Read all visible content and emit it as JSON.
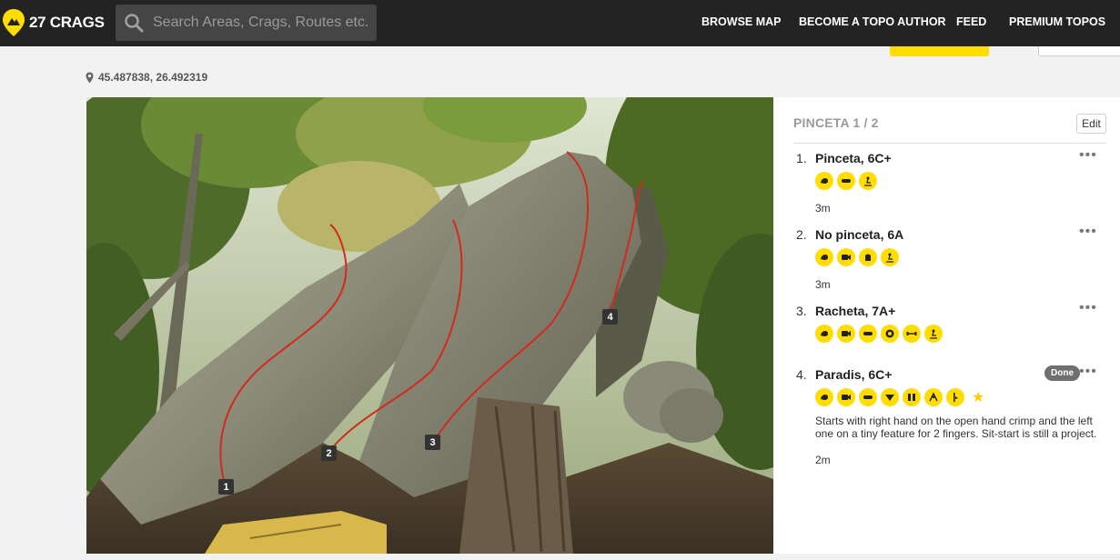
{
  "header": {
    "brand": "27 CRAGS",
    "search_placeholder": "Search Areas, Crags, Routes etc.",
    "nav": [
      "BROWSE MAP",
      "BECOME A TOPO AUTHOR",
      "FEED",
      "PREMIUM TOPOS"
    ]
  },
  "location": {
    "coordinates": "45.487838, 26.492319"
  },
  "topo": {
    "title": "PINCETA 1 / 2",
    "edit_label": "Edit",
    "photo_markers": [
      "1",
      "2",
      "3",
      "4"
    ],
    "routes": [
      {
        "number": "1.",
        "name": "Pinceta, 6C+",
        "length": "3m",
        "icons": [
          "crimp-icon",
          "pinch-icon",
          "sit-start-icon"
        ]
      },
      {
        "number": "2.",
        "name": "No pinceta, 6A",
        "length": "3m",
        "icons": [
          "crimp-icon",
          "video-icon",
          "sloper-icon",
          "sit-start-icon"
        ]
      },
      {
        "number": "3.",
        "name": "Racheta, 7A+",
        "length": "",
        "icons": [
          "crimp-icon",
          "video-icon",
          "pinch-icon",
          "pocket-icon",
          "dyno-icon",
          "sit-start-icon"
        ]
      },
      {
        "number": "4.",
        "name": "Paradis, 6C+",
        "length": "2m",
        "status": "Done",
        "description": "Starts with right hand on the open hand crimp and the left one on a tiny feature for 2 fingers. Sit-start is still a project.",
        "icons": [
          "crimp-icon",
          "video-icon",
          "pinch-icon",
          "sloper-icon",
          "pad-icon",
          "technical-icon",
          "arete-icon",
          "star-icon"
        ]
      }
    ]
  },
  "colors": {
    "accent": "#ffdd00",
    "topbar": "#232323",
    "route_line": "#d22a1e"
  }
}
